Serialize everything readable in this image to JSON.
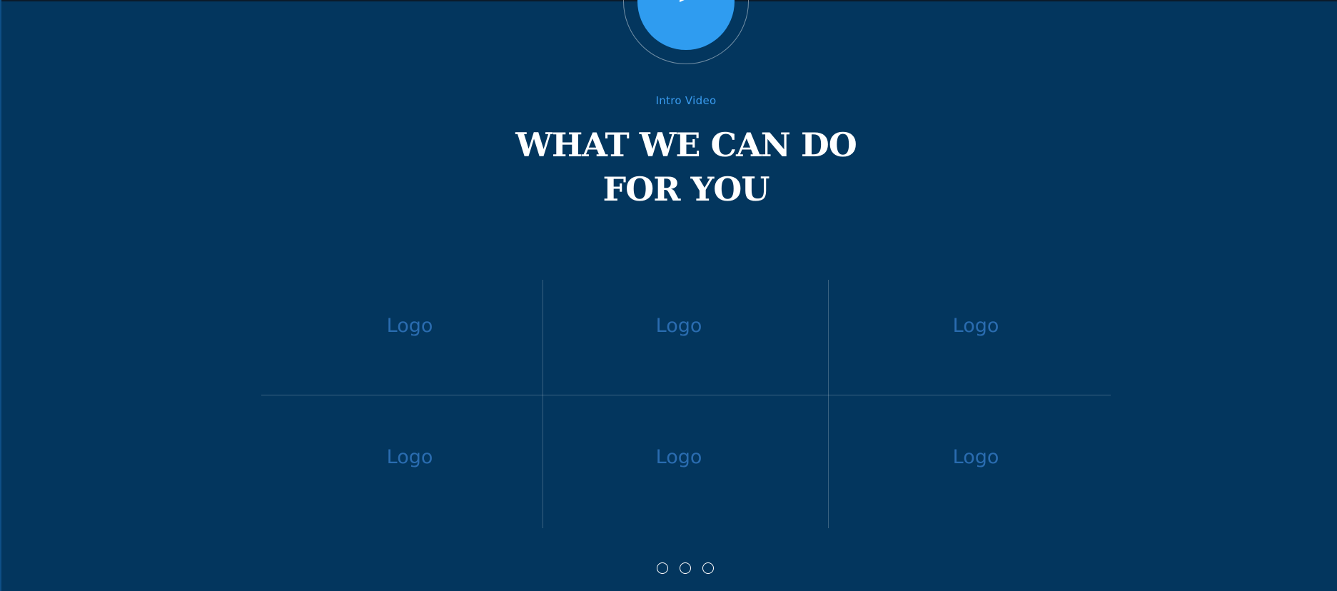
{
  "video": {
    "eyebrow": "Intro Video",
    "play_icon": "play-icon"
  },
  "section": {
    "headline_line1": "WHAT WE  CAN DO",
    "headline_line2": "FOR YOU"
  },
  "logos": [
    {
      "label": "Logo"
    },
    {
      "label": "Logo"
    },
    {
      "label": "Logo"
    },
    {
      "label": "Logo"
    },
    {
      "label": "Logo"
    },
    {
      "label": "Logo"
    }
  ],
  "pager": {
    "count": 3
  },
  "colors": {
    "background": "#03365e",
    "accent": "#2f9cf0",
    "logo_text": "#2a6cb0"
  }
}
